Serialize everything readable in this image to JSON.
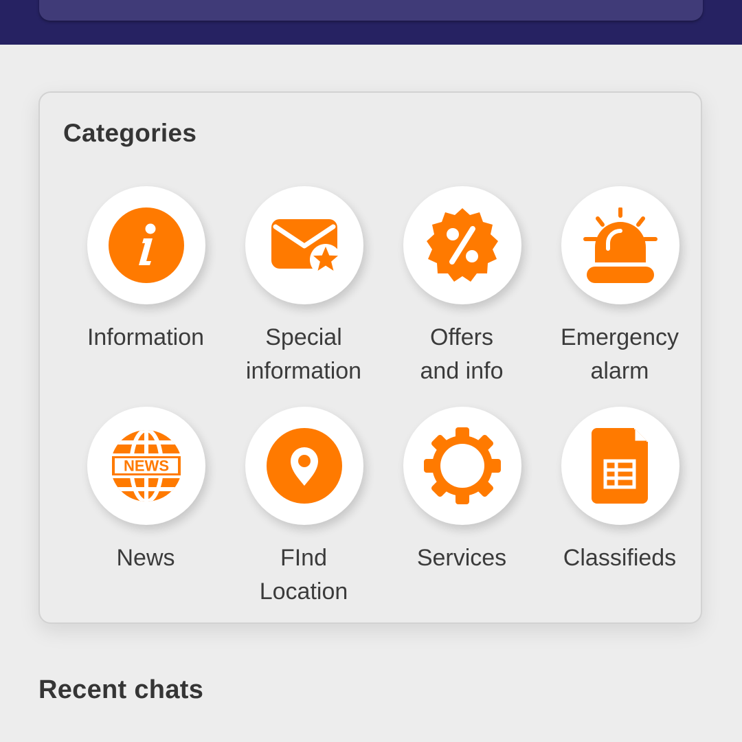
{
  "colors": {
    "header_bg": "#262262",
    "header_card": "#403b78",
    "accent": "#ff7a00",
    "page_bg": "#ededed"
  },
  "categories": {
    "title": "Categories",
    "items": [
      {
        "line1": "Information",
        "line2": "",
        "icon": "info-icon"
      },
      {
        "line1": "Special",
        "line2": "information",
        "icon": "mail-star-icon"
      },
      {
        "line1": "Offers",
        "line2": "and info",
        "icon": "discount-badge-icon"
      },
      {
        "line1": "Emergency",
        "line2": "alarm",
        "icon": "siren-icon"
      },
      {
        "line1": "News",
        "line2": "",
        "icon": "news-globe-icon"
      },
      {
        "line1": "FInd",
        "line2": "Location",
        "icon": "location-pin-icon"
      },
      {
        "line1": "Services",
        "line2": "",
        "icon": "gear-icon"
      },
      {
        "line1": "Classifieds",
        "line2": "",
        "icon": "spreadsheet-icon"
      }
    ]
  },
  "recent_chats": {
    "title": "Recent chats"
  }
}
